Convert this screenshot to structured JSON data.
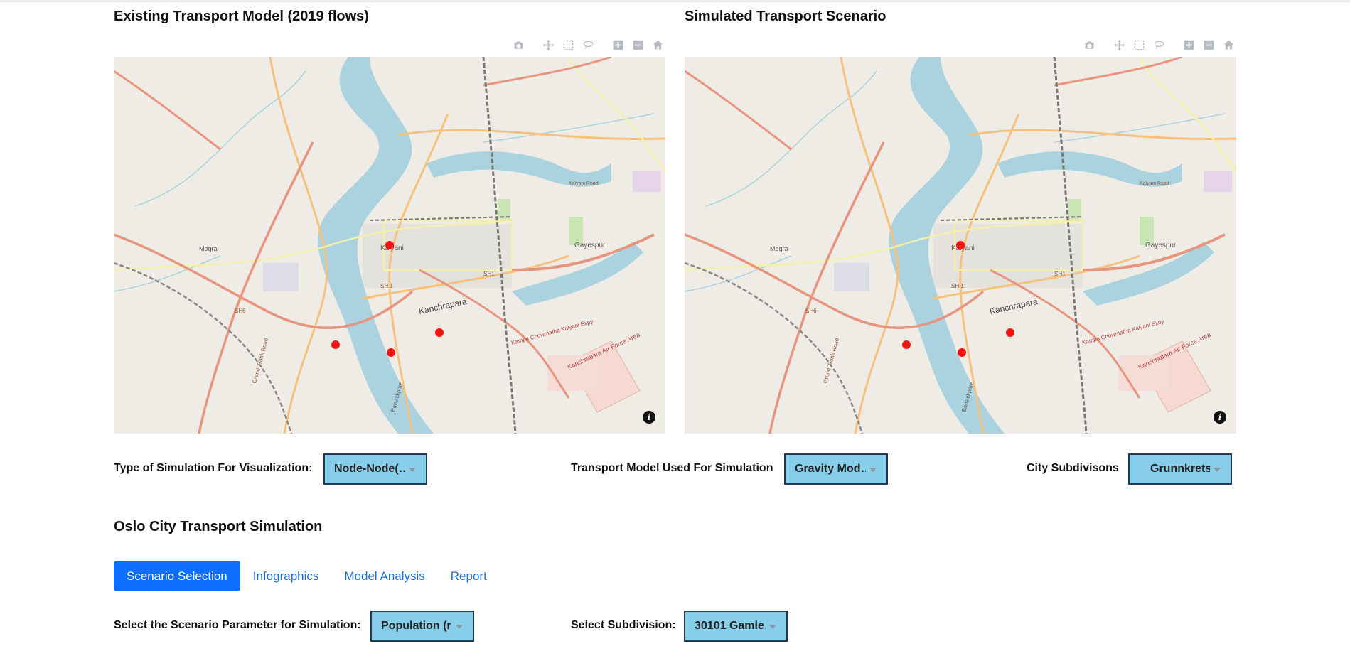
{
  "panels": {
    "left": {
      "title": "Existing Transport Model (2019 flows)"
    },
    "right": {
      "title": "Simulated Transport Scenario"
    }
  },
  "modebar": [
    "camera-icon",
    "pan-icon",
    "box-select-icon",
    "lasso-icon",
    "zoom-in-icon",
    "zoom-out-icon",
    "home-icon"
  ],
  "map": {
    "labels": [
      "Kalyani",
      "Gayespur",
      "Kanchrapara",
      "Mogra",
      "SH 1",
      "SH1",
      "SH6",
      "Grand Trunk Road",
      "Kalyani Road",
      "Kampa Chowmatha Kalyani Expy",
      "Kanchrapara Air Force Area",
      "Barrackpore"
    ],
    "info_label": "i",
    "colors": {
      "river": "#aad3df",
      "land": "#efece5",
      "node": "#f21313",
      "primary_road": "#e8957f",
      "secondary_road": "#f6c17c",
      "tertiary_road": "#f4f0a8",
      "rail": "#777777"
    }
  },
  "controls": {
    "sim_type": {
      "label": "Type of Simulation For Visualization:",
      "value": "Node-Node(…"
    },
    "transport_model": {
      "label": "Transport Model Used For Simulation",
      "value": "Gravity Mod…"
    },
    "subdivisions": {
      "label": "City Subdivisons",
      "value": "Grunnkrets"
    }
  },
  "section": {
    "title": "Oslo City Transport Simulation"
  },
  "tabs": [
    {
      "label": "Scenario Selection",
      "active": true
    },
    {
      "label": "Infographics",
      "active": false
    },
    {
      "label": "Model Analysis",
      "active": false
    },
    {
      "label": "Report",
      "active": false
    }
  ],
  "scenario": {
    "parameter": {
      "label": "Select the Scenario Parameter for Simulation:",
      "value": "Population (r…"
    },
    "subdivision": {
      "label": "Select Subdivision:",
      "value": "30101 Gamle…"
    }
  },
  "dropdown_color": "#87ceeb",
  "active_tab_color": "#0d6efd"
}
